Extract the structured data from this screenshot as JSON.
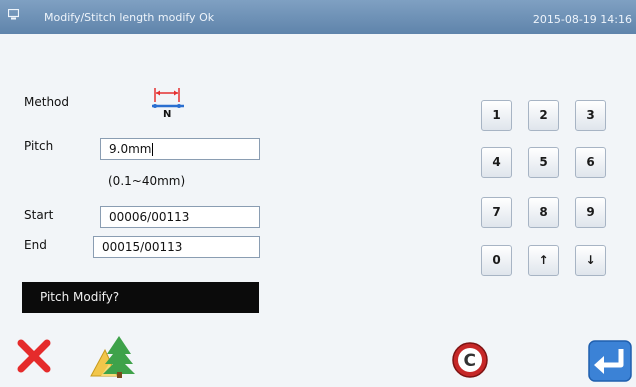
{
  "header": {
    "title": "Modify/Stitch length modify  Ok",
    "datetime": "2015-08-19 14:16",
    "bar_color": "#6f93b8"
  },
  "form": {
    "method_label": "Method",
    "method_icon": "stitch-length-icon",
    "method_icon_letter": "N",
    "pitch_label": "Pitch",
    "pitch_value": "9.0mm",
    "pitch_range": "(0.1~40mm)",
    "start_label": "Start",
    "start_value": "00006/00113",
    "end_label": "End",
    "end_value": "00015/00113"
  },
  "prompt": {
    "text": "Pitch Modify?"
  },
  "keypad": {
    "keys": [
      "1",
      "2",
      "3",
      "4",
      "5",
      "6",
      "7",
      "8",
      "9",
      "0",
      "↑",
      "↓"
    ]
  },
  "buttons": {
    "cancel_icon": "close-icon",
    "tree_icon": "tree-icon",
    "clear_icon": "clear-icon",
    "clear_letter": "C",
    "enter_icon": "enter-icon"
  }
}
